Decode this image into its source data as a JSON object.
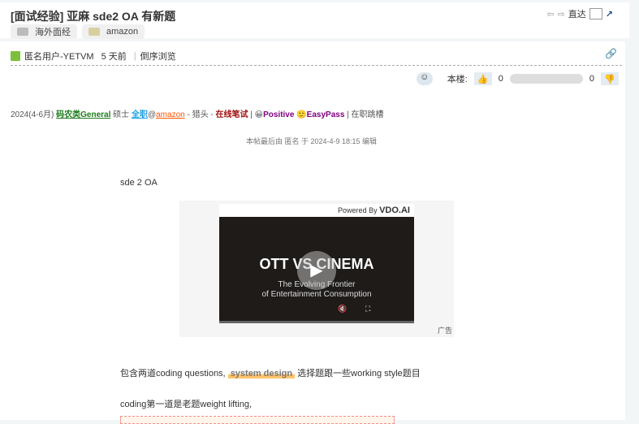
{
  "header": {
    "title": "[面试经验] 亚麻 sde2 OA 有新题",
    "tags": [
      "海外面经",
      "amazon"
    ],
    "goto_label": "直达"
  },
  "meta": {
    "user": "匿名用户-YETVM",
    "time": "5 天前",
    "reverse": "倒序浏览"
  },
  "vote": {
    "floor_label": "本楼:",
    "up": "0",
    "down": "0",
    "up_icon": "thumbs-up-icon",
    "down_icon": "thumbs-down-icon"
  },
  "info": {
    "period": "2024(4-6月)",
    "category": "码农类General",
    "degree": "硕士",
    "jobtype": "全职",
    "at": "@",
    "company": "amazon",
    "source": "- 猎头 -",
    "format": "在线笔试",
    "sep": "|",
    "exp": "Positive",
    "difficulty": "EasyPass",
    "status": "| 在职跳槽"
  },
  "edit_note": "本帖最后由 匿名 于 2024-4-9 18:15 编辑",
  "body": {
    "line1": "sde 2 OA",
    "line2_a": "包含两道coding questions,",
    "line2_hl": "system design",
    "line2_b": "选择题跟一些working style题目",
    "line3": "coding第一道是老题weight lifting,"
  },
  "ad": {
    "powered": "Powered By",
    "brand": "VDO.AI",
    "title": "OTT VS CINEMA",
    "subtitle1": "The Evolving Frontier",
    "subtitle2": "of Entertainment Consumption",
    "label": "广告"
  }
}
